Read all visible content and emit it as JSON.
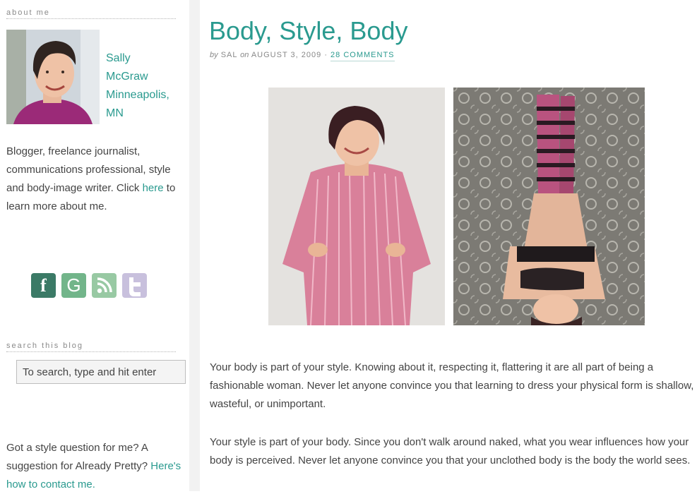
{
  "sidebar": {
    "about_heading": "about me",
    "author_name_line1": "Sally",
    "author_name_line2": "McGraw",
    "location_line1": "Minneapolis,",
    "location_line2": "MN",
    "bio_text": "Blogger, freelance journalist, communications professional, style and body-image writer. Click ",
    "bio_link": "here",
    "bio_tail": " to learn more about me.",
    "social": [
      {
        "icon": "facebook-icon",
        "glyph": "f"
      },
      {
        "icon": "google-icon",
        "glyph": "G"
      },
      {
        "icon": "rss-icon",
        "glyph": ""
      },
      {
        "icon": "twitter-icon",
        "glyph": ""
      }
    ],
    "search_heading": "search this blog",
    "search_placeholder": "To search, type and hit enter",
    "contact_text": "Got a style question for me? A suggestion for Already Pretty?",
    "contact_link": "Here's how to contact me."
  },
  "post": {
    "title": "Body, Style, Body",
    "meta_by": "by",
    "meta_author": "SAL",
    "meta_on": "on",
    "meta_date": "AUGUST 3, 2009",
    "meta_sep": "·",
    "comments_link": "28 COMMENTS",
    "paragraph1": "Your body is part of your style. Knowing about it, respecting it, flattering it are all part of being a fashionable woman. Never let anyone convince you that learning to dress your physical form is shallow, wasteful, or unimportant.",
    "paragraph2": "Your style is part of your body. Since you don't walk around naked, what you wear influences how your body is perceived. Never let anyone convince you that your unclothed body is the body the world sees."
  },
  "colors": {
    "accent": "#2a9a8f",
    "body_text": "#444444",
    "muted": "#888888"
  }
}
